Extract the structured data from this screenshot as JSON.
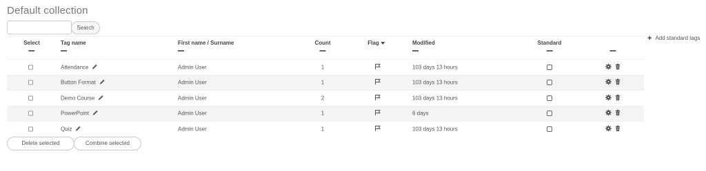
{
  "title": "Default collection",
  "search": {
    "placeholder": "",
    "button_label": "Search"
  },
  "add_standard_tags": {
    "label": "Add standard tags",
    "icon": "plus-icon"
  },
  "columns": {
    "select": "Select",
    "tag_name": "Tag name",
    "owner": "First name / Surname",
    "count": "Count",
    "flag": "Flag",
    "modified": "Modified",
    "standard": "Standard"
  },
  "rows": [
    {
      "tag": "Attendance",
      "owner": "Admin User",
      "count": "1",
      "modified": "103 days 13 hours",
      "standard": false,
      "selected": false
    },
    {
      "tag": "Button Format",
      "owner": "Admin User",
      "count": "1",
      "modified": "103 days 13 hours",
      "standard": false,
      "selected": false
    },
    {
      "tag": "Demo Course",
      "owner": "Admin User",
      "count": "2",
      "modified": "103 days 13 hours",
      "standard": false,
      "selected": false
    },
    {
      "tag": "PowerPoint",
      "owner": "Admin User",
      "count": "1",
      "modified": "6 days",
      "standard": false,
      "selected": false
    },
    {
      "tag": "Quiz",
      "owner": "Admin User",
      "count": "1",
      "modified": "103 days 13 hours",
      "standard": false,
      "selected": false
    }
  ],
  "footer": {
    "delete_label": "Delete selected",
    "combine_label": "Combine selected"
  }
}
